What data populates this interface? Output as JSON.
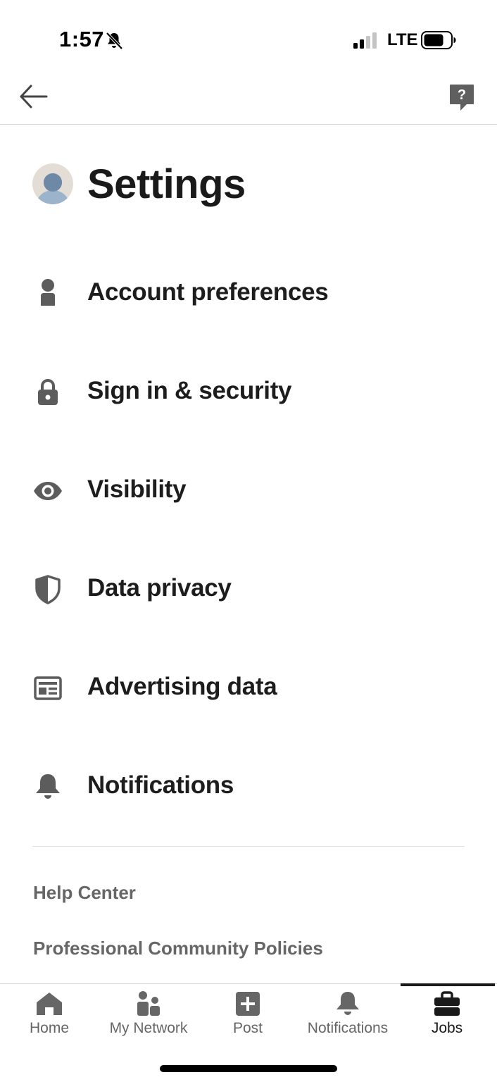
{
  "status_bar": {
    "time": "1:57",
    "network": "LTE",
    "icons": [
      "bell-off-icon",
      "signal-icon",
      "battery-icon"
    ]
  },
  "top_bar": {
    "icons": [
      "arrow-left-icon",
      "help-question-icon"
    ]
  },
  "header": {
    "title": "Settings",
    "avatar_icon": "avatar-icon"
  },
  "menu": {
    "items": [
      {
        "label": "Account preferences",
        "icon": "person-icon"
      },
      {
        "label": "Sign in & security",
        "icon": "lock-icon"
      },
      {
        "label": "Visibility",
        "icon": "eye-icon"
      },
      {
        "label": "Data privacy",
        "icon": "shield-icon"
      },
      {
        "label": "Advertising data",
        "icon": "ad-card-icon"
      },
      {
        "label": "Notifications",
        "icon": "bell-icon"
      }
    ]
  },
  "footer_links": [
    {
      "label": "Help Center"
    },
    {
      "label": "Professional Community Policies"
    }
  ],
  "bottom_nav": {
    "active": "Jobs",
    "tabs": [
      {
        "label": "Home",
        "icon": "home-icon"
      },
      {
        "label": "My Network",
        "icon": "network-icon"
      },
      {
        "label": "Post",
        "icon": "plus-icon"
      },
      {
        "label": "Notifications",
        "icon": "bell-icon"
      },
      {
        "label": "Jobs",
        "icon": "briefcase-icon"
      }
    ]
  },
  "colors": {
    "text_primary": "#1d1d1d",
    "text_secondary": "#666666",
    "icon_gray": "#666666",
    "divider": "#d6d6d6"
  }
}
